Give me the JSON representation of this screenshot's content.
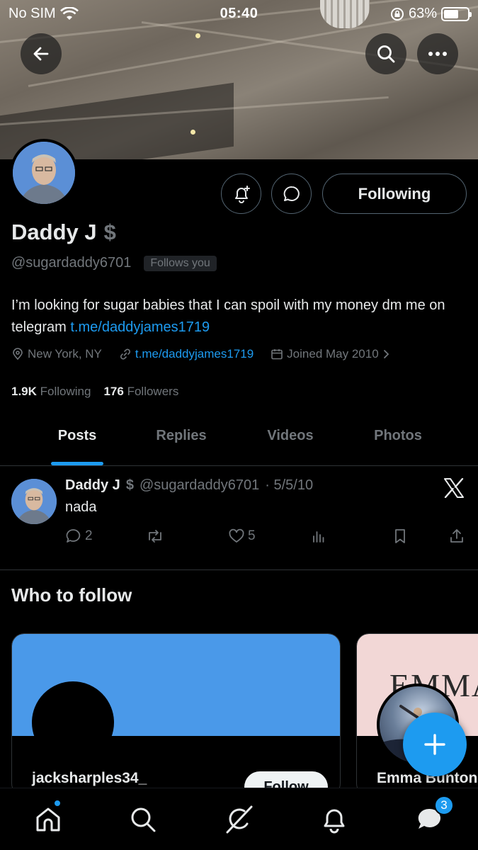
{
  "status_bar": {
    "carrier": "No SIM",
    "time": "05:40",
    "battery": "63%",
    "battery_level": 0.63
  },
  "profile": {
    "name": "Daddy J",
    "handle": "@sugardaddy6701",
    "follows_you": "Follows you",
    "following_button": "Following",
    "bio_text": "I’m looking for sugar babies that I can spoil with my money dm me on telegram ",
    "bio_link": "t.me/daddyjames1719",
    "location": "New York, NY",
    "website": "t.me/daddyjames1719",
    "joined": "Joined May 2010",
    "following_count": "1.9K",
    "following_label": "Following",
    "followers_count": "176",
    "followers_label": "Followers"
  },
  "tabs": [
    {
      "label": "Posts",
      "active": true
    },
    {
      "label": "Replies",
      "active": false
    },
    {
      "label": "Videos",
      "active": false
    },
    {
      "label": "Photos",
      "active": false
    }
  ],
  "post": {
    "name": "Daddy J",
    "handle": "@sugardaddy6701",
    "date": "· 5/5/10",
    "text": "nada",
    "replies": "2",
    "likes": "5"
  },
  "who_to_follow": {
    "title": "Who to follow",
    "cards": [
      {
        "name": "jacksharples34_",
        "button": "Follow"
      },
      {
        "name": "Emma Bunton",
        "banner_text": "EMMA"
      }
    ]
  },
  "nav": {
    "messages_badge": "3"
  },
  "colors": {
    "accent": "#1d9bf0",
    "background": "#000000",
    "muted": "#71767b",
    "text": "#e7e9ea"
  },
  "icons": [
    "back-arrow-icon",
    "search-icon",
    "more-icon",
    "notification-add-icon",
    "message-icon",
    "location-icon",
    "link-icon",
    "calendar-icon",
    "chevron-right-icon",
    "x-logo-icon",
    "reply-icon",
    "repost-icon",
    "like-icon",
    "views-icon",
    "bookmark-icon",
    "share-icon",
    "compose-plus-icon",
    "home-icon",
    "explore-icon",
    "grok-icon",
    "bell-icon",
    "messages-icon"
  ]
}
